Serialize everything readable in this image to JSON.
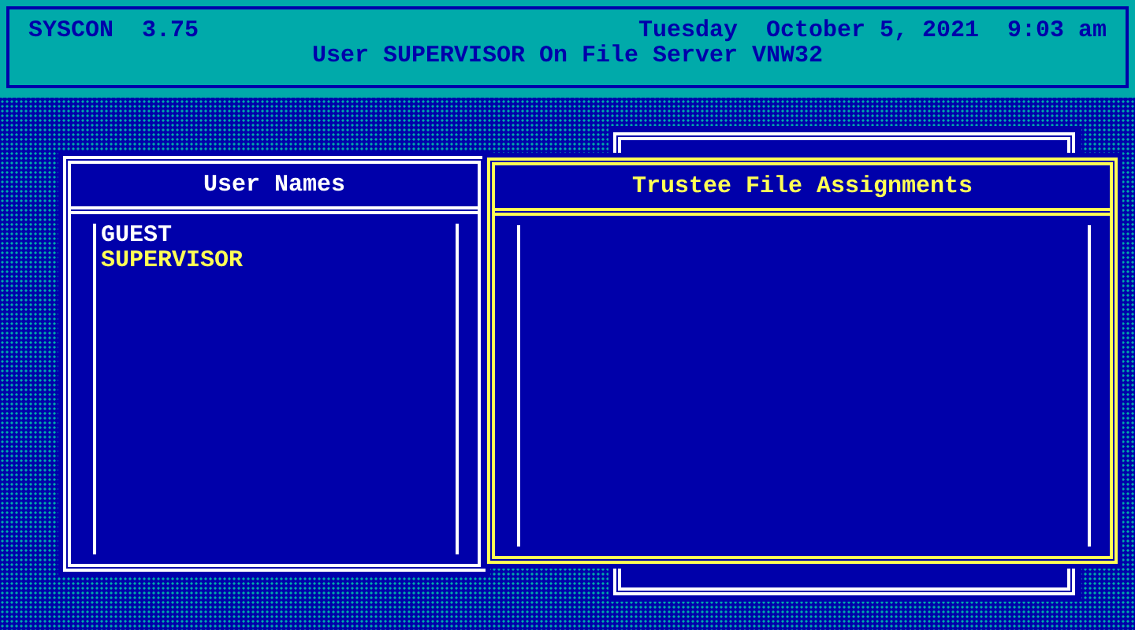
{
  "header": {
    "app": "SYSCON",
    "version": "3.75",
    "day": "Tuesday",
    "date": "October 5, 2021",
    "time": "9:03 am",
    "status": "User SUPERVISOR On File Server VNW32"
  },
  "windows": [
    {
      "title": "User Names",
      "active": false,
      "items": [
        {
          "label": "GUEST",
          "selected": false
        },
        {
          "label": "SUPERVISOR",
          "selected": true
        }
      ]
    },
    {
      "title": "Trustee File Assignments",
      "active": true
    }
  ]
}
